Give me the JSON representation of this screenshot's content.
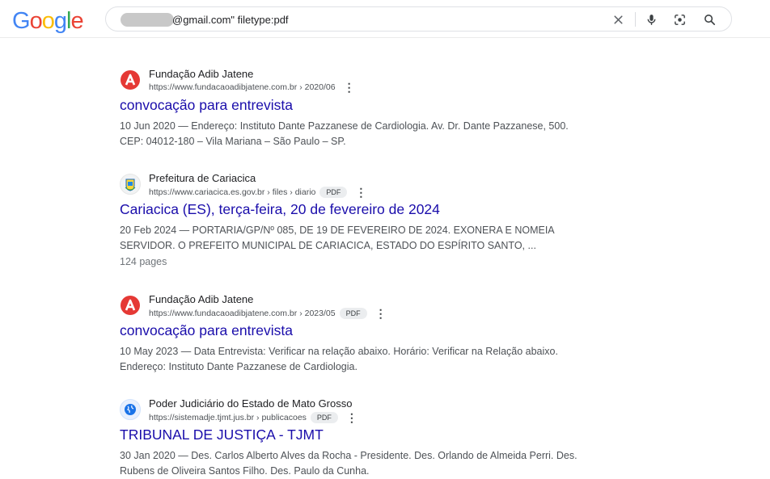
{
  "logo": "Google",
  "search": {
    "query": "@gmail.com\" filetype:pdf"
  },
  "icons": {
    "clear": "close-icon",
    "voice": "microphone-icon",
    "lens": "camera-lens-icon",
    "search": "search-icon"
  },
  "results": [
    {
      "site_name": "Fundação Adib Jatene",
      "url": "https://www.fundacaoadibjatene.com.br › 2020/06",
      "pdf": "",
      "title": "convocação para entrevista",
      "snippet_line1": "10 Jun 2020 — Endereço: Instituto Dante Pazzanese de Cardiologia. Av. Dr. Dante Pazzanese, 500.",
      "snippet_line2": "CEP: 04012-180 – Vila Mariana – São Paulo – SP.",
      "pages": ""
    },
    {
      "site_name": "Prefeitura de Cariacica",
      "url": "https://www.cariacica.es.gov.br › files › diario",
      "pdf": "PDF",
      "title": "Cariacica (ES), terça-feira, 20 de fevereiro de 2024",
      "snippet_line1": "20 Feb 2024 — PORTARIA/GP/Nº 085, DE 19 DE FEVEREIRO DE 2024. EXONERA E NOMEIA",
      "snippet_line2": "SERVIDOR. O PREFEITO MUNICIPAL DE CARIACICA, ESTADO DO ESPÍRITO SANTO, ...",
      "pages": "124 pages"
    },
    {
      "site_name": "Fundação Adib Jatene",
      "url": "https://www.fundacaoadibjatene.com.br › 2023/05",
      "pdf": "PDF",
      "title": "convocação para entrevista",
      "snippet_line1": "10 May 2023 — Data Entrevista: Verificar na relação abaixo. Horário: Verificar na Relação abaixo.",
      "snippet_line2": "Endereço: Instituto Dante Pazzanese de Cardiologia.",
      "pages": ""
    },
    {
      "site_name": "Poder Judiciário do Estado de Mato Grosso",
      "url": "https://sistemadje.tjmt.jus.br › publicacoes",
      "pdf": "PDF",
      "title": "TRIBUNAL DE JUSTIÇA - TJMT",
      "snippet_line1": "30 Jan 2020 — Des. Carlos Alberto Alves da Rocha - Presidente. Des. Orlando de Almeida Perri. Des.",
      "snippet_line2": "Rubens de Oliveira Santos Filho. Des. Paulo da Cunha.",
      "pages": ""
    }
  ]
}
